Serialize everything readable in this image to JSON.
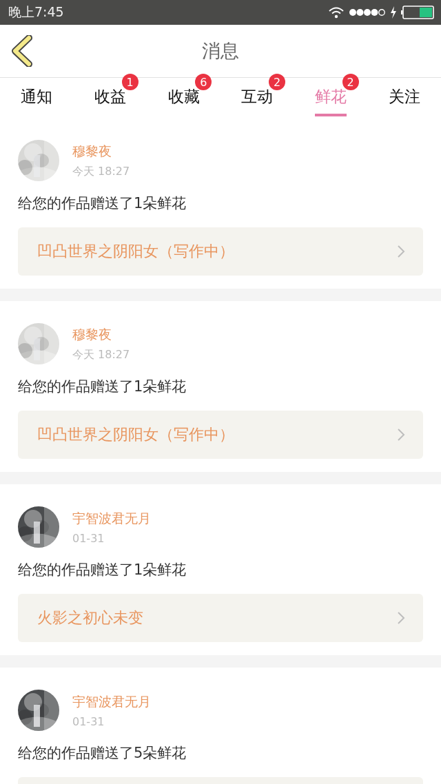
{
  "status_bar": {
    "time": "晚上7:45"
  },
  "nav": {
    "title": "消息"
  },
  "tabs": [
    {
      "label": "通知",
      "selected": false
    },
    {
      "label": "收益",
      "selected": false,
      "badge": "1"
    },
    {
      "label": "收藏",
      "selected": false,
      "badge": "6"
    },
    {
      "label": "互动",
      "selected": false,
      "badge": "2"
    },
    {
      "label": "鲜花",
      "selected": true,
      "badge": "2"
    },
    {
      "label": "关注",
      "selected": false
    }
  ],
  "messages": [
    {
      "name": "穆黎夜",
      "time": "今天 18:27",
      "text": "给您的作品赠送了1朵鲜花",
      "book": "凹凸世界之阴阳女（写作中）"
    },
    {
      "name": "穆黎夜",
      "time": "今天 18:27",
      "text": "给您的作品赠送了1朵鲜花",
      "book": "凹凸世界之阴阳女（写作中）"
    },
    {
      "name": "宇智波君无月",
      "time": "01-31",
      "text": "给您的作品赠送了1朵鲜花",
      "book": "火影之初心未变"
    },
    {
      "name": "宇智波君无月",
      "time": "01-31",
      "text": "给您的作品赠送了5朵鲜花"
    }
  ]
}
